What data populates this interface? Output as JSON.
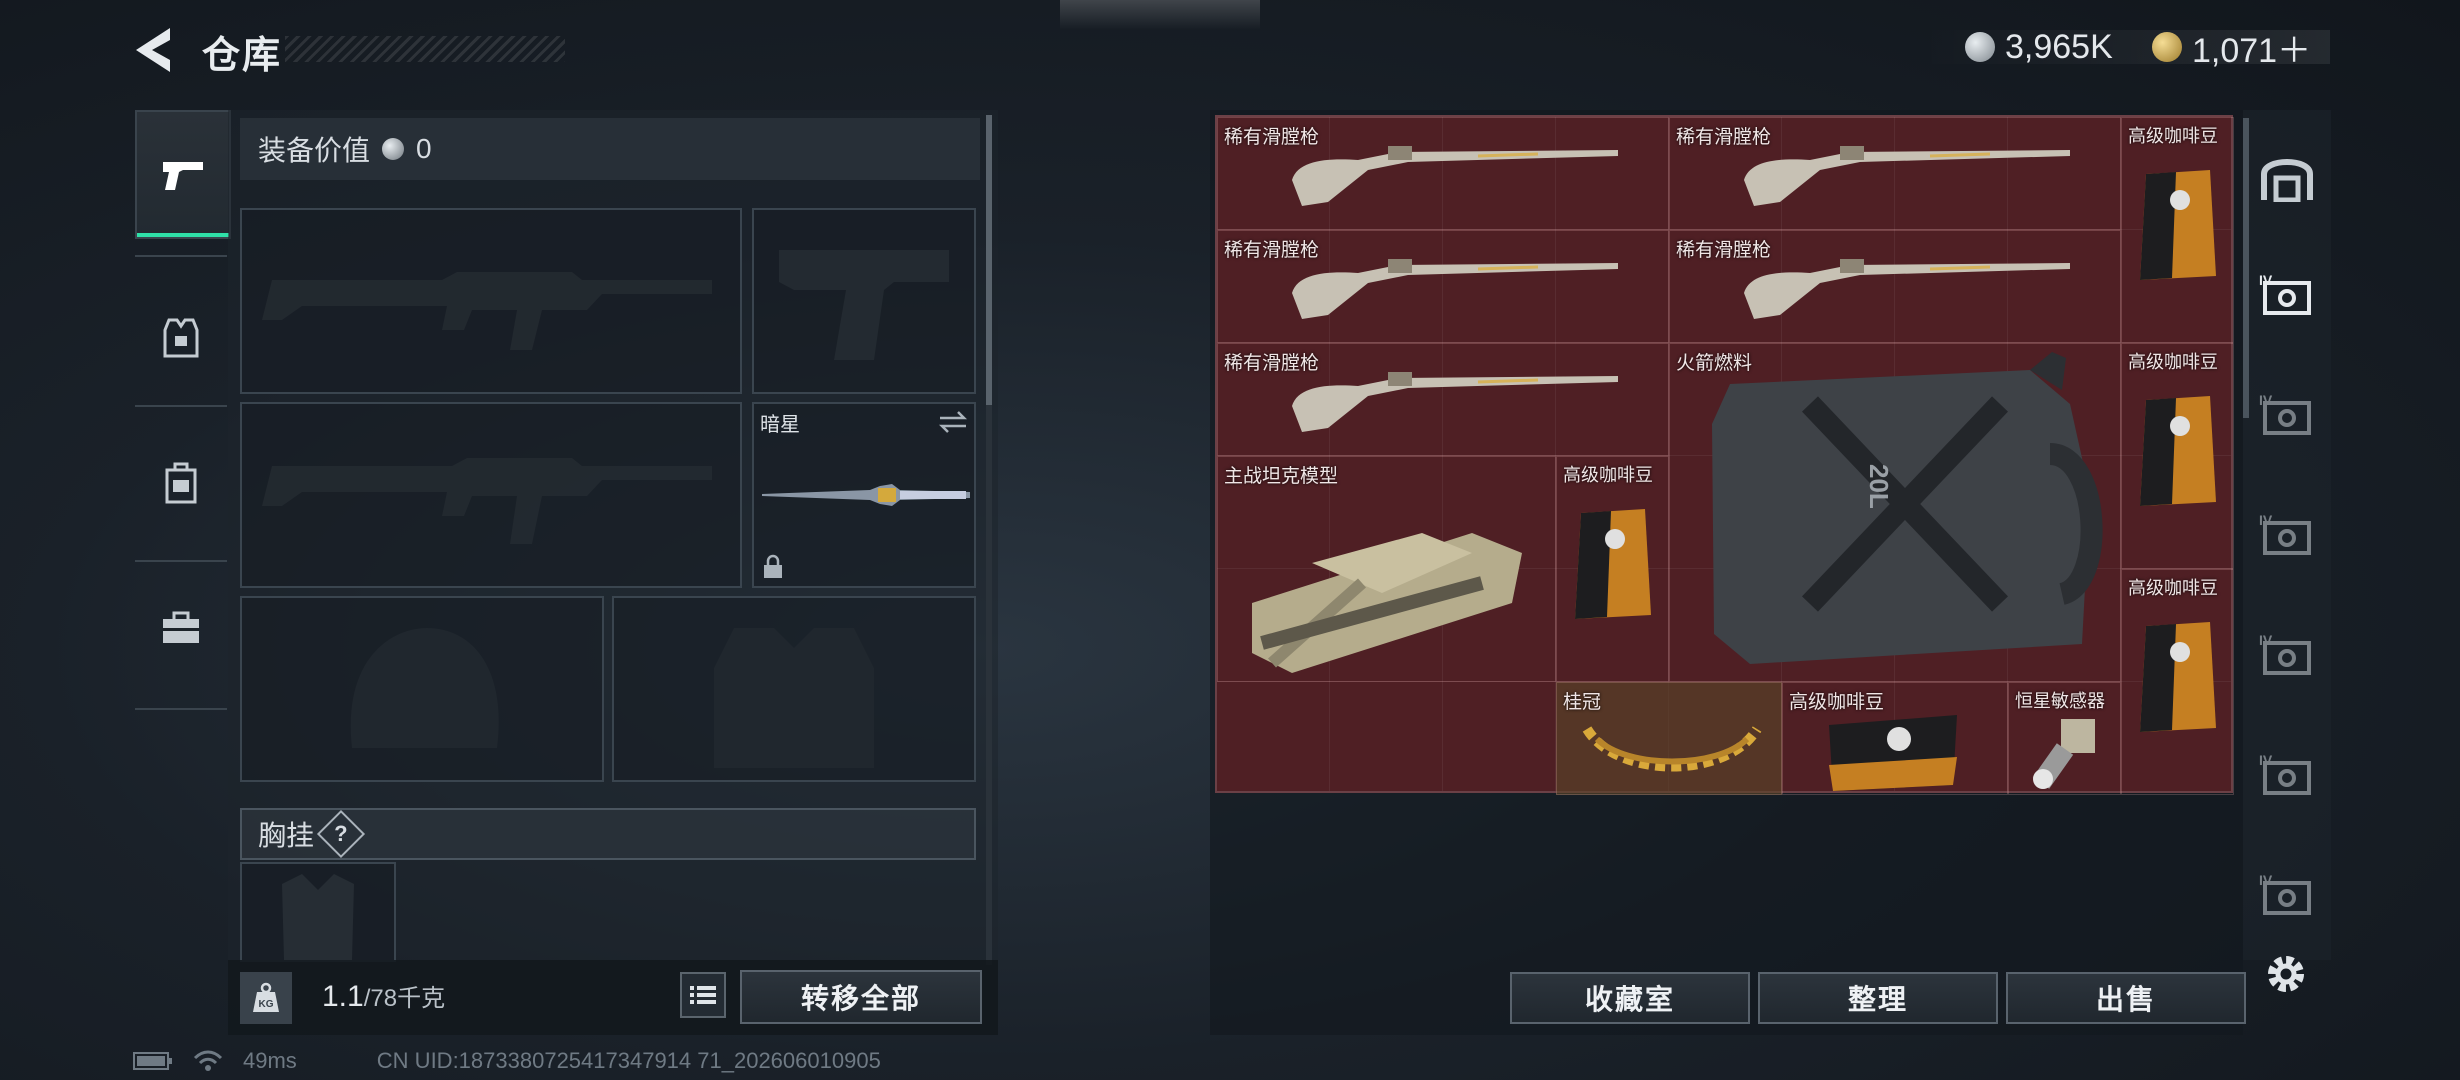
{
  "header": {
    "title": "仓库",
    "currency": [
      {
        "name": "silver-coin",
        "value": "3,965K",
        "color": "#b8bfc6"
      },
      {
        "name": "gold-coin",
        "value": "1,071＋",
        "color": "#d6b25a"
      }
    ]
  },
  "loadout": {
    "value_label": "装备价值",
    "value": "0",
    "melee_name": "暗星",
    "chest_label": "胸挂",
    "chest_help": "?",
    "weight": "1.1",
    "weight_max": "/78千克",
    "transfer_all": "转移全部"
  },
  "storage": {
    "items": [
      {
        "label": "稀有滑膛枪",
        "type": "rifle"
      },
      {
        "label": "稀有滑膛枪",
        "type": "rifle"
      },
      {
        "label": "高级咖啡豆",
        "type": "coffee"
      },
      {
        "label": "稀有滑膛枪",
        "type": "rifle"
      },
      {
        "label": "稀有滑膛枪",
        "type": "rifle"
      },
      {
        "label": "稀有滑膛枪",
        "type": "rifle"
      },
      {
        "label": "火箭燃料",
        "type": "jerrycan"
      },
      {
        "label": "高级咖啡豆",
        "type": "coffee"
      },
      {
        "label": "主战坦克模型",
        "type": "tank"
      },
      {
        "label": "高级咖啡豆",
        "type": "coffee"
      },
      {
        "label": "高级咖啡豆",
        "type": "coffee"
      },
      {
        "label": "桂冠",
        "type": "laurel"
      },
      {
        "label": "高级咖啡豆",
        "type": "coffee"
      },
      {
        "label": "恒星敏感器",
        "type": "sensor"
      }
    ],
    "jerrycan_text": "20L"
  },
  "actions": {
    "collection": "收藏室",
    "organize": "整理",
    "sell": "出售"
  },
  "right_tabs": [
    "safehouse-icon",
    "storage-iv-icon",
    "storage-iv-icon",
    "storage-iv-icon",
    "storage-iv-icon",
    "storage-iv-icon",
    "storage-iv-icon"
  ],
  "right_tab_label": "IV",
  "footer": {
    "ping": "49ms",
    "uid": "CN UID:1873380725417347914 71_202606010905"
  }
}
